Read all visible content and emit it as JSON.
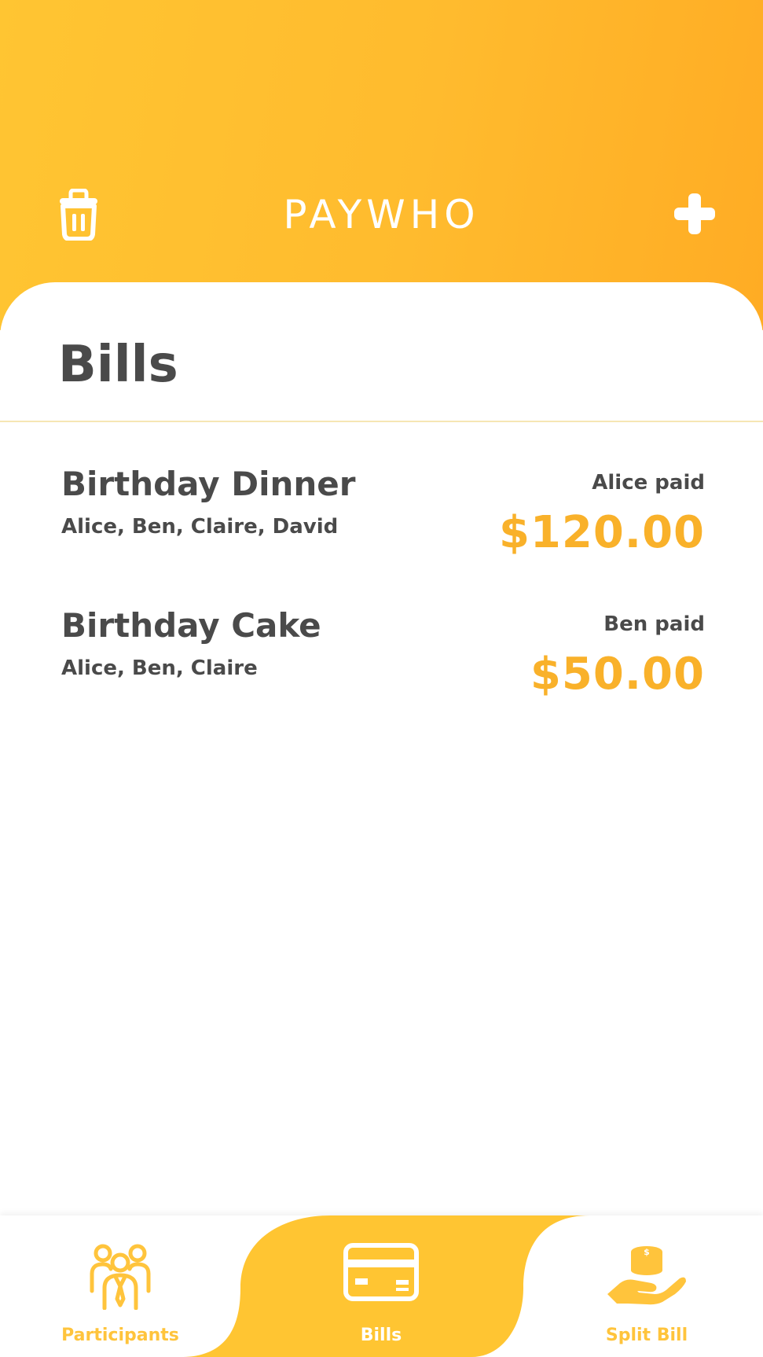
{
  "header": {
    "title": "PAYWHO",
    "delete_icon": "trash-icon",
    "add_icon": "plus-icon",
    "colors": {
      "gradient_start": "#ffc532",
      "gradient_end": "#ffac24"
    }
  },
  "main": {
    "title": "Bills",
    "bills": [
      {
        "name": "Birthday Dinner",
        "participants": "Alice, Ben, Claire, David",
        "payer": "Alice paid",
        "amount": "$120.00"
      },
      {
        "name": "Birthday Cake",
        "participants": "Alice, Ben, Claire",
        "payer": "Ben paid",
        "amount": "$50.00"
      }
    ],
    "colors": {
      "text": "#4a4a4a",
      "amount": "#f9b12a"
    }
  },
  "tabbar": {
    "tabs": [
      {
        "label": "Participants",
        "icon": "participants-icon"
      },
      {
        "label": "Bills",
        "icon": "credit-card-icon",
        "active": true
      },
      {
        "label": "Split Bill",
        "icon": "coins-hand-icon"
      }
    ],
    "colors": {
      "active_bg": "#ffc532",
      "inactive": "#ffc43c"
    }
  }
}
